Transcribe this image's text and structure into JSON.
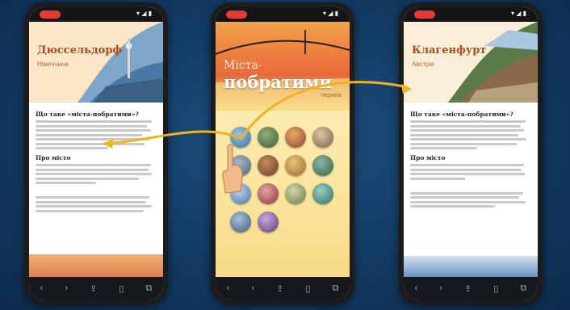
{
  "phones": [
    {
      "status_text": "▾ ◢ ▮",
      "city": "Дюссельдорф",
      "country": "Німеччина",
      "heading_1": "Що таке «міста-побратими»?",
      "heading_2": "Про місто"
    },
    {
      "status_text": "▾ ◢ ▮",
      "title_line1": "Міста-",
      "title_line2": "побратими",
      "subtitle": "Чернігів"
    },
    {
      "status_text": "▾ ◢ ▮",
      "city": "Клагенфурт",
      "country": "Австрія",
      "heading_1": "Що таке «міста-побратими»?",
      "heading_2": "Про місто"
    }
  ],
  "nav_icons": [
    "back-icon",
    "forward-icon",
    "share-icon",
    "book-icon",
    "tabs-icon"
  ],
  "colors": {
    "background": "#123a62",
    "title_accent": "#b04a1a",
    "arrow": "#f2b21c",
    "record": "#e53935"
  }
}
